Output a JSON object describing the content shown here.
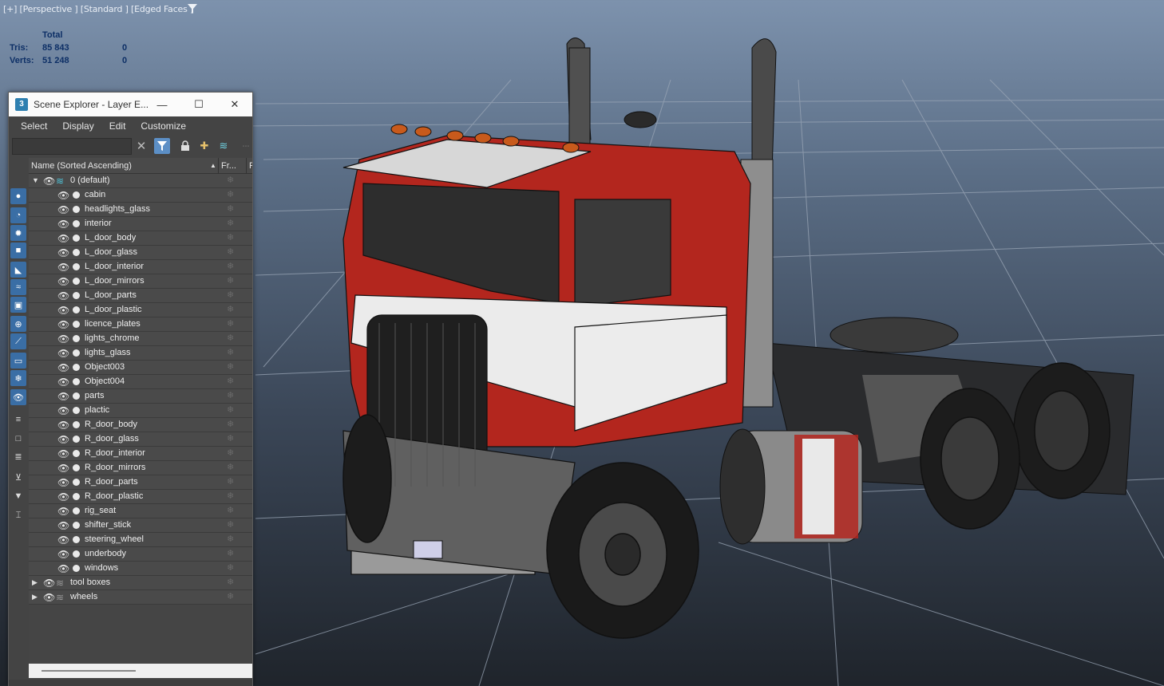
{
  "viewport": {
    "label": "[+] [Perspective ] [Standard ] [Edged Faces ]",
    "stats": {
      "header": "Total",
      "tris_label": "Tris:",
      "tris_value": "85 843",
      "tris_selected": "0",
      "verts_label": "Verts:",
      "verts_value": "51 248",
      "verts_selected": "0"
    }
  },
  "scene_explorer": {
    "title": "Scene Explorer - Layer E...",
    "app_icon_text": "3",
    "window_controls": {
      "minimize": "—",
      "maximize": "☐",
      "close": "✕"
    },
    "menu": [
      "Select",
      "Display",
      "Edit",
      "Customize"
    ],
    "search": {
      "value": "",
      "placeholder": ""
    },
    "columns": {
      "name": "Name (Sorted Ascending)",
      "freeze": "Fr...",
      "extra": "F"
    },
    "layers": [
      {
        "name": "0 (default)",
        "expanded": true,
        "children": [
          "cabin",
          "headlights_glass",
          "interior",
          "L_door_body",
          "L_door_glass",
          "L_door_interior",
          "L_door_mirrors",
          "L_door_parts",
          "L_door_plastic",
          "licence_plates",
          "lights_chrome",
          "lights_glass",
          "Object003",
          "Object004",
          "parts",
          "plactic",
          "R_door_body",
          "R_door_glass",
          "R_door_interior",
          "R_door_mirrors",
          "R_door_parts",
          "R_door_plastic",
          "rig_seat",
          "shifter_stick",
          "steering_wheel",
          "underbody",
          "windows"
        ]
      },
      {
        "name": "tool boxes",
        "expanded": false,
        "children": []
      },
      {
        "name": "wheels",
        "expanded": false,
        "children": []
      }
    ],
    "sidebar_icons": [
      "sphere-icon",
      "shapes-icon",
      "light-icon",
      "camera-icon",
      "helper-icon",
      "spacewarp-icon",
      "group-icon",
      "xref-icon",
      "bone-icon",
      "container-icon",
      "frozen-icon",
      "eye-icon",
      "list-icon",
      "square-icon",
      "notes-icon",
      "filter-plus-icon",
      "filter-icon",
      "bracket-icon"
    ]
  },
  "colors": {
    "viewport_top": "#7d92ad",
    "viewport_bottom": "#1f242b",
    "truck_red": "#b3261e",
    "accent_blue": "#5c8fc6",
    "stats_text": "#0d2f66"
  }
}
